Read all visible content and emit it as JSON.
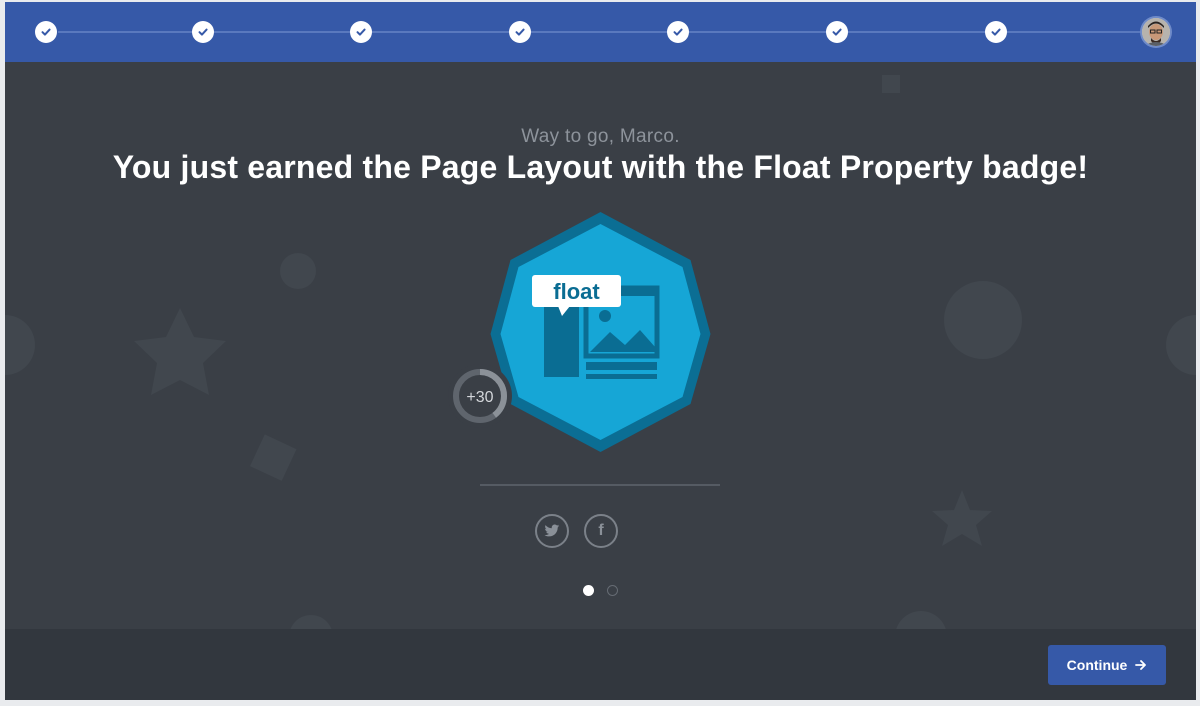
{
  "progress": {
    "steps_completed": 7,
    "step_icon": "check-icon",
    "current_step_icon": "user-avatar"
  },
  "celebration": {
    "subtitle": "Way to go, Marco.",
    "headline": "You just earned the Page Layout with the Float Property badge!"
  },
  "badge": {
    "label": "float",
    "points": "+30",
    "colors": {
      "outer": "#0b6e94",
      "inner": "#16a6d6",
      "art": "#0a6d93",
      "points_ring": "#6e747c"
    }
  },
  "share": {
    "twitter_icon": "twitter-icon",
    "facebook_icon": "facebook-icon",
    "facebook_glyph": "f"
  },
  "pagination": {
    "total": 2,
    "active": 1
  },
  "footer": {
    "continue_label": "Continue"
  },
  "colors": {
    "primary": "#3659a8",
    "background": "#3a3f46",
    "footer": "#32373e"
  }
}
